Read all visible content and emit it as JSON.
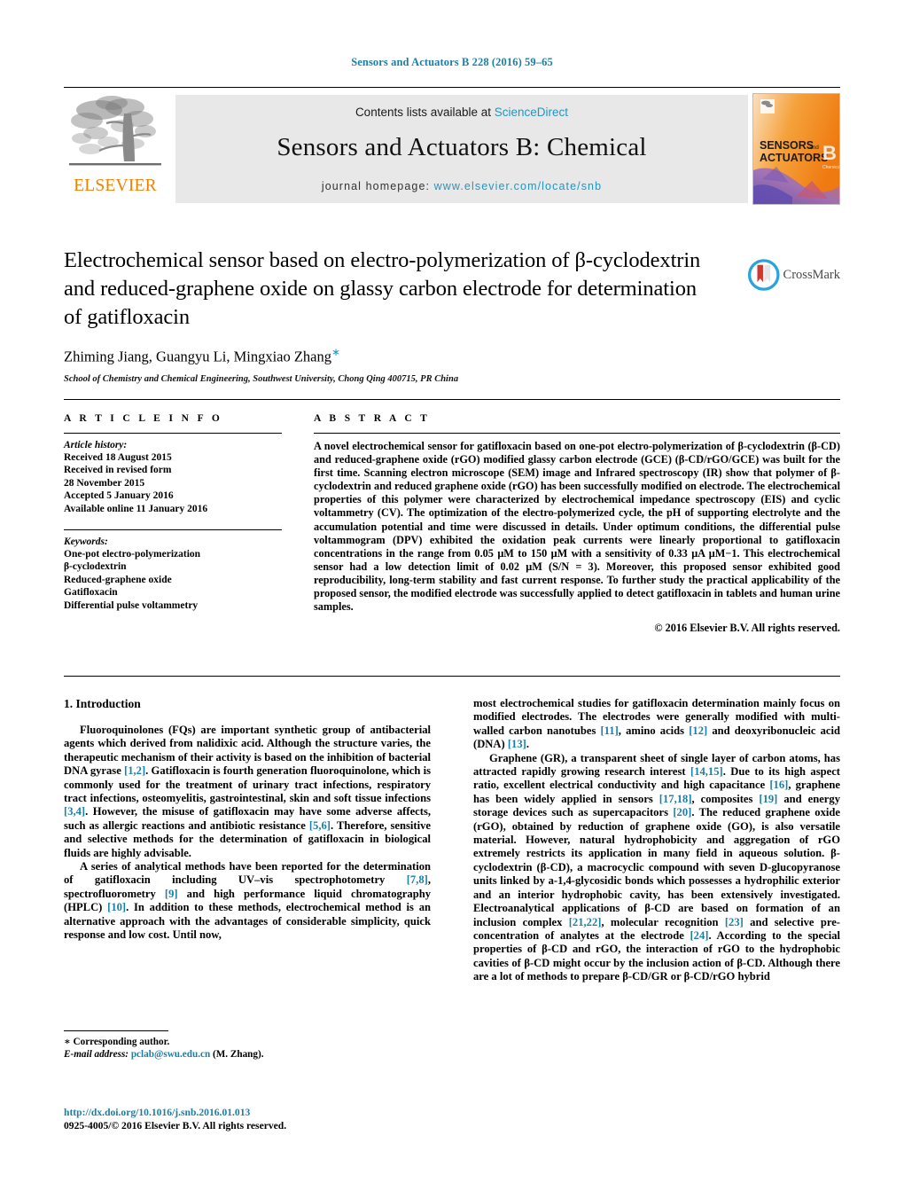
{
  "running_head": "Sensors and Actuators B 228 (2016) 59–65",
  "journal_header": {
    "publisher_name": "ELSEVIER",
    "contents_prefix": "Contents lists available at ",
    "contents_link": "ScienceDirect",
    "journal_title": "Sensors and Actuators B: Chemical",
    "homepage_prefix": "journal homepage:",
    "homepage_url": "www.elsevier.com/locate/snb",
    "cover_line1": "SENSORS",
    "cover_and": "and",
    "cover_line2": "ACTUATORS",
    "cover_letter": "B",
    "cover_sub": "Chemical"
  },
  "crossmark": {
    "label": "CrossMark"
  },
  "article": {
    "title": "Electrochemical sensor based on electro-polymerization of β-cyclodextrin and reduced-graphene oxide on glassy carbon electrode for determination of gatifloxacin",
    "authors": "Zhiming Jiang, Guangyu Li, Mingxiao Zhang",
    "author_star": "∗",
    "affiliation": "School of Chemistry and Chemical Engineering, Southwest University, Chong Qing 400715, PR China"
  },
  "article_info": {
    "label": "A R T I C L E   I N F O",
    "history_heading": "Article history:",
    "history": [
      "Received 18 August 2015",
      "Received in revised form",
      "28 November 2015",
      "Accepted 5 January 2016",
      "Available online 11 January 2016"
    ],
    "keywords_heading": "Keywords:",
    "keywords": [
      "One-pot electro-polymerization",
      "β-cyclodextrin",
      "Reduced-graphene oxide",
      "Gatifloxacin",
      "Differential pulse voltammetry"
    ]
  },
  "abstract": {
    "label": "A B S T R A C T",
    "text": "A novel electrochemical sensor for gatifloxacin based on one-pot electro-polymerization of β-cyclodextrin (β-CD) and reduced-graphene oxide (rGO) modified glassy carbon electrode (GCE) (β-CD/rGO/GCE) was built for the first time. Scanning electron microscope (SEM) image and Infrared spectroscopy (IR) show that polymer of β-cyclodextrin and reduced graphene oxide (rGO) has been successfully modified on electrode. The electrochemical properties of this polymer were characterized by electrochemical impedance spectroscopy (EIS) and cyclic voltammetry (CV). The optimization of the electro-polymerized cycle, the pH of supporting electrolyte and the accumulation potential and time were discussed in details. Under optimum conditions, the differential pulse voltammogram (DPV) exhibited the oxidation peak currents were linearly proportional to gatifloxacin concentrations in the range from 0.05 μM to 150 μM with a sensitivity of 0.33 μA μM−1. This electrochemical sensor had a low detection limit of 0.02 μM (S/N = 3). Moreover, this proposed sensor exhibited good reproducibility, long-term stability and fast current response. To further study the practical applicability of the proposed sensor, the modified electrode was successfully applied to detect gatifloxacin in tablets and human urine samples.",
    "copyright": "© 2016 Elsevier B.V. All rights reserved."
  },
  "introduction": {
    "heading": "1.  Introduction",
    "left_paragraphs": [
      "Fluoroquinolones (FQs) are important synthetic group of antibacterial agents which derived from nalidixic acid. Although the structure varies, the therapeutic mechanism of their activity is based on the inhibition of bacterial DNA gyrase [1,2]. Gatifloxacin is fourth generation fluoroquinolone, which is commonly used for the treatment of urinary tract infections, respiratory tract infections, osteomyelitis, gastrointestinal, skin and soft tissue infections [3,4]. However, the misuse of gatifloxacin may have some adverse affects, such as allergic reactions and antibiotic resistance [5,6]. Therefore, sensitive and selective methods for the determination of gatifloxacin in biological fluids are highly advisable.",
      "A series of analytical methods have been reported for the determination of gatifloxacin including UV–vis spectrophotometry [7,8], spectrofluorometry [9] and high performance liquid chromatography (HPLC) [10]. In addition to these methods, electrochemical method is an alternative approach with the advantages of considerable simplicity, quick response and low cost. Until now,"
    ],
    "right_paragraphs": [
      "most electrochemical studies for gatifloxacin determination mainly focus on modified electrodes. The electrodes were generally modified with multi-walled carbon nanotubes [11], amino acids [12] and deoxyribonucleic acid (DNA) [13].",
      "Graphene (GR), a transparent sheet of single layer of carbon atoms, has attracted rapidly growing research interest [14,15]. Due to its high aspect ratio, excellent electrical conductivity and high capacitance [16], graphene has been widely applied in sensors [17,18], composites [19] and energy storage devices such as supercapacitors [20]. The reduced graphene oxide (rGO), obtained by reduction of graphene oxide (GO), is also versatile material. However, natural hydrophobicity and aggregation of rGO extremely restricts its application in many field in aqueous solution. β-cyclodextrin (β-CD), a macrocyclic compound with seven D-glucopyranose units linked by a-1,4-glycosidic bonds which possesses a hydrophilic exterior and an interior hydrophobic cavity, has been extensively investigated. Electroanalytical applications of β-CD are based on formation of an inclusion complex [21,22], molecular recognition [23] and selective pre-concentration of analytes at the electrode [24]. According to the special properties of β-CD and rGO, the interaction of rGO to the hydrophobic cavities of β-CD might occur by the inclusion action of β-CD. Although there are a lot of methods to prepare β-CD/GR or β-CD/rGO hybrid"
    ]
  },
  "footnote": {
    "corresponding": "∗ Corresponding author.",
    "email_label": "E-mail address:",
    "email": "pclab@swu.edu.cn",
    "email_suffix": "(M. Zhang)."
  },
  "footer": {
    "doi": "http://dx.doi.org/10.1016/j.snb.2016.01.013",
    "issn": "0925-4005/© 2016 Elsevier B.V. All rights reserved."
  },
  "colors": {
    "link_blue": "#1a7fa8",
    "science_direct_blue": "#2196c4",
    "elsevier_orange": "#f08000",
    "header_grey": "#e8e8e8"
  }
}
